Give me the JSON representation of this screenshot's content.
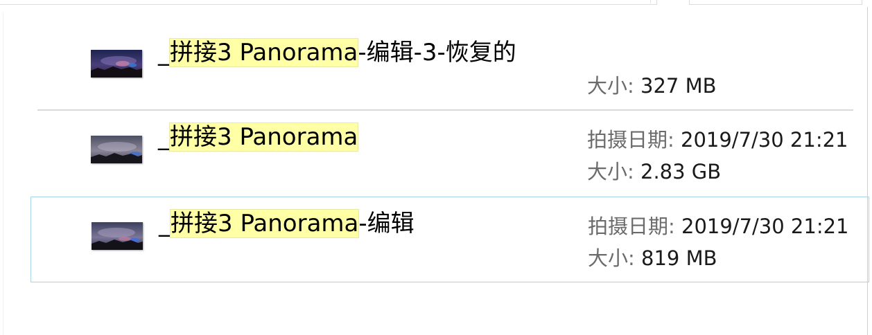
{
  "results": [
    {
      "prefix": "_",
      "match": "拼接3 Panorama",
      "suffix": "-编辑-3-恢复的",
      "size_label": "大小:",
      "size_value": "327 MB",
      "thumbnail_icon": "panorama-thumbnail-icon"
    },
    {
      "prefix": "_",
      "match": "拼接3 Panorama",
      "suffix": "",
      "date_label": "拍摄日期:",
      "date_value": "2019/7/30 21:21",
      "size_label": "大小:",
      "size_value": "2.83 GB",
      "thumbnail_icon": "panorama-thumbnail-icon"
    },
    {
      "prefix": "_",
      "match": "拼接3 Panorama",
      "suffix": "-编辑",
      "date_label": "拍摄日期:",
      "date_value": "2019/7/30 21:21",
      "size_label": "大小:",
      "size_value": "819 MB",
      "thumbnail_icon": "panorama-thumbnail-icon",
      "selected": true
    }
  ],
  "colors": {
    "highlight": "#ffffa6",
    "selection_border": "#a7d4e6",
    "label_gray": "#6b6b6b"
  }
}
